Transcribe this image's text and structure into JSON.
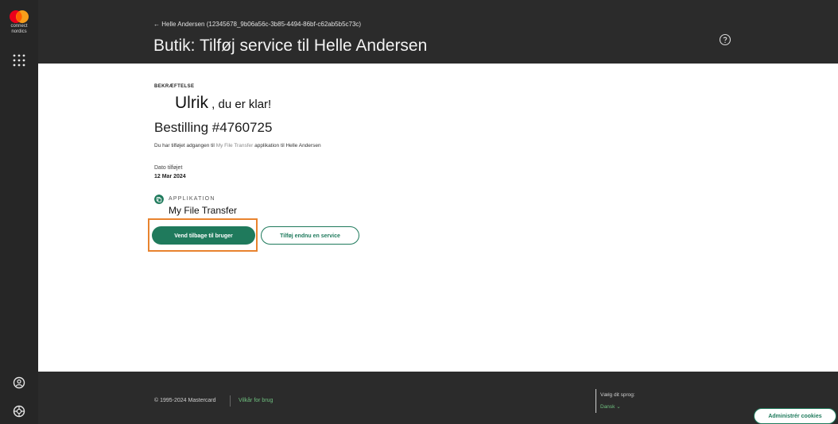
{
  "brand": {
    "logo_text_line1": "connect",
    "logo_text_line2": "nordics",
    "logo_colors": [
      "#eb001b",
      "#f79e1b",
      "#ff5f00"
    ]
  },
  "header": {
    "breadcrumb": "← Helle Andersen (12345678_9b06a56c-3b85-4494-86bf-c62ab5b5c73c)",
    "title": "Butik: Tilføj service til Helle Andersen"
  },
  "main": {
    "eyebrow": "BEKRÆFTELSE",
    "greeting_name": "Ulrik",
    "greeting_rest": " , du er klar!",
    "order_title": "Bestilling #4760725",
    "desc_prefix": "Du har tilføjet adgangen til ",
    "desc_app": "My File Transfer",
    "desc_suffix": " applikation til Helle Andersen",
    "date_label": "Dato tilføjet",
    "date_value": "12 Mar 2024",
    "app_label": "APPLIKATION",
    "app_name": "My File Transfer",
    "primary_button": "Vend tilbage til bruger",
    "secondary_button": "Tilføj endnu en service"
  },
  "footer": {
    "copyright": "© 1995-2024 Mastercard",
    "terms": "Vilkår for brug",
    "lang_label": "Vælg dit sprog:",
    "lang_value": "Dansk ⌄",
    "cookie_button": "Administrér cookies"
  },
  "colors": {
    "accent": "#1f7a5c",
    "highlight": "#e8832e",
    "dark_bg": "#2b2b2b"
  }
}
